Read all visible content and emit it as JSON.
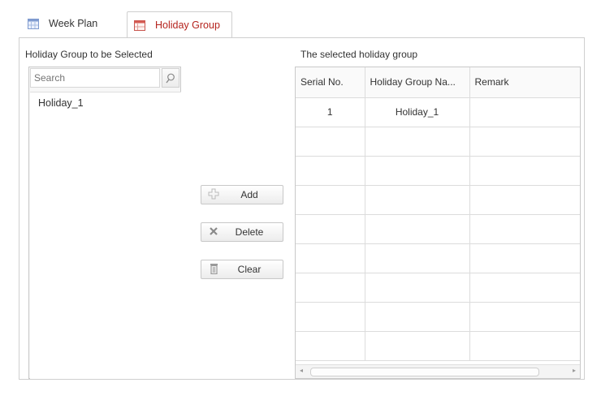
{
  "tabs": [
    {
      "label": "Week Plan",
      "icon": "calendar-icon",
      "active": false
    },
    {
      "label": "Holiday Group",
      "icon": "holiday-calendar-icon",
      "active": true
    }
  ],
  "left": {
    "title": "Holiday Group to be Selected",
    "search": {
      "placeholder": "Search",
      "value": ""
    },
    "items": [
      "Holiday_1"
    ]
  },
  "buttons": {
    "add": "Add",
    "delete": "Delete",
    "clear": "Clear"
  },
  "right": {
    "title": "The selected holiday group",
    "columns": [
      "Serial No.",
      "Holiday Group Na...",
      "Remark"
    ],
    "rows": [
      {
        "serial": "1",
        "name": "Holiday_1",
        "remark": ""
      }
    ]
  },
  "colors": {
    "active_tab_text": "#b5231d",
    "border": "#cfcfcf"
  }
}
